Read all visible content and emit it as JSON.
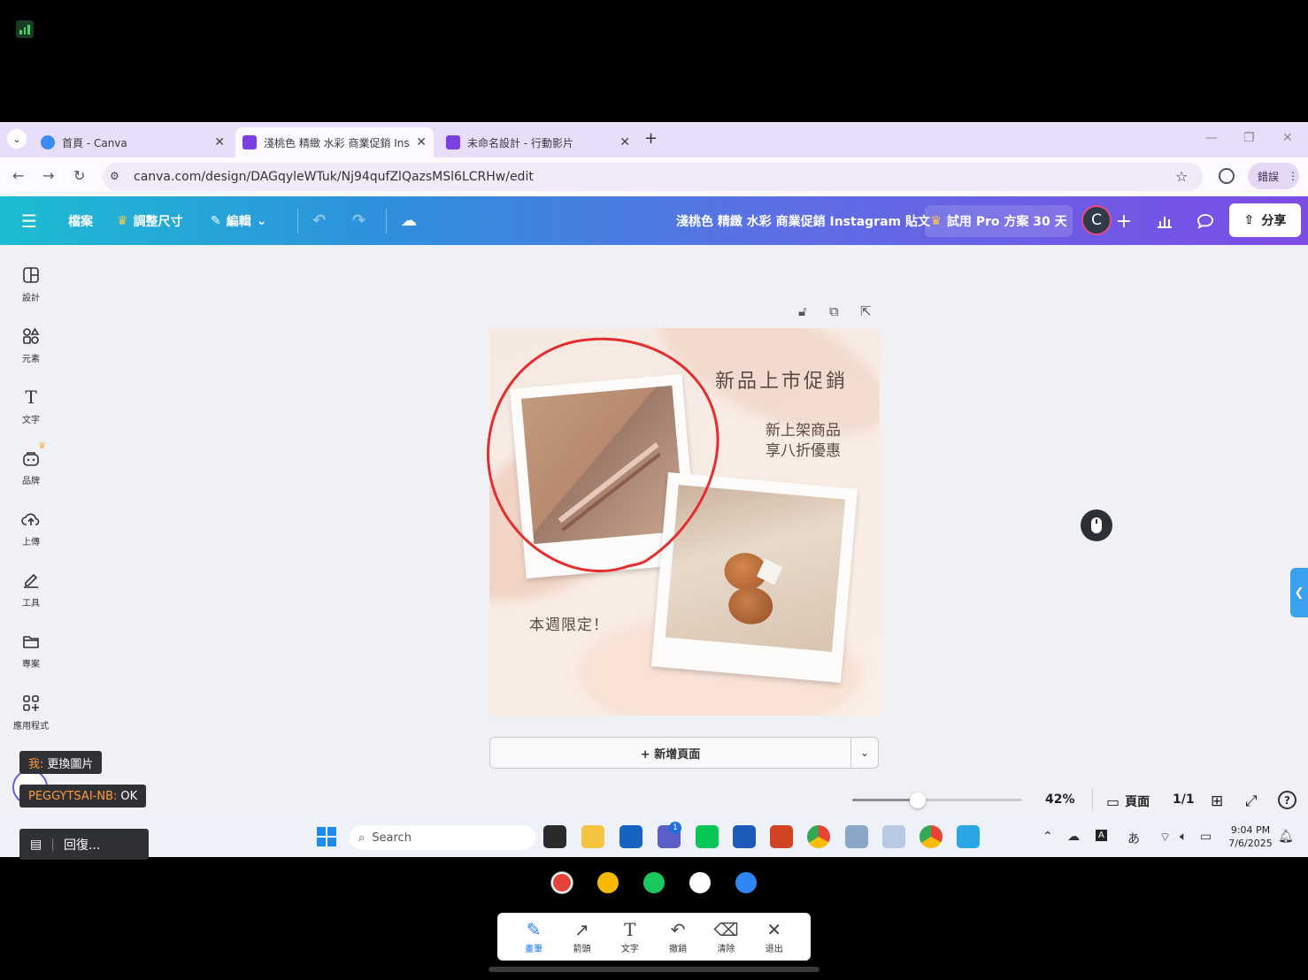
{
  "browser": {
    "tabs": [
      {
        "title": "首頁 - Canva",
        "color": "#3b8bf5"
      },
      {
        "title": "淺桃色 精緻 水彩 商業促銷 Inst",
        "color": "#7b3fe4"
      },
      {
        "title": "未命名設計 - 行動影片",
        "color": "#7b3fe4"
      }
    ],
    "url": "canva.com/design/DAGqyleWTuk/Nj94qufZlQazsMSl6LCRHw/edit",
    "error_label": "錯誤"
  },
  "header": {
    "file": "檔案",
    "resize": "調整尺寸",
    "edit": "編輯",
    "doc_title": "淺桃色 精緻 水彩 商業促銷 Instagram 貼文",
    "pro_trial": "試用 Pro 方案 30 天",
    "avatar_letter": "C",
    "share": "分享"
  },
  "sidebar": {
    "items": [
      {
        "label": "設計",
        "icon": "layout-icon"
      },
      {
        "label": "元素",
        "icon": "shapes-icon"
      },
      {
        "label": "文字",
        "icon": "text-icon"
      },
      {
        "label": "品牌",
        "icon": "brand-icon"
      },
      {
        "label": "上傳",
        "icon": "upload-cloud-icon"
      },
      {
        "label": "工具",
        "icon": "pen-tool-icon"
      },
      {
        "label": "專案",
        "icon": "folder-icon"
      },
      {
        "label": "應用程式",
        "icon": "apps-icon"
      }
    ]
  },
  "design": {
    "title": "新品上市促銷",
    "subtitle_line1": "新上架商品",
    "subtitle_line2": "享八折優惠",
    "limited": "本週限定！"
  },
  "add_page": "+ 新增頁面",
  "footer": {
    "zoom": "42%",
    "zoom_level": 0.42,
    "pages_label": "頁面",
    "page_count": "1/1"
  },
  "chat": {
    "msg1_name": "我:",
    "msg1_text": "更換圖片",
    "msg2_name": "PEGGYTSAI-NB:",
    "msg2_text": "OK",
    "reply_placeholder": "回復..."
  },
  "taskbar": {
    "search_placeholder": "Search",
    "teams_badge": "1",
    "time": "9:04 PM",
    "date": "7/6/2025"
  },
  "annotation": {
    "colors": [
      "#e5443b",
      "#f7b900",
      "#19c95f",
      "#ffffff",
      "#2f86f6"
    ],
    "selected_color": "#e5443b",
    "tools": [
      {
        "label": "畫筆",
        "icon": "pencil-icon"
      },
      {
        "label": "箭頭",
        "icon": "arrow-icon"
      },
      {
        "label": "文字",
        "icon": "text-icon"
      },
      {
        "label": "撤銷",
        "icon": "undo-icon"
      },
      {
        "label": "清除",
        "icon": "eraser-icon"
      },
      {
        "label": "退出",
        "icon": "close-icon"
      }
    ]
  }
}
